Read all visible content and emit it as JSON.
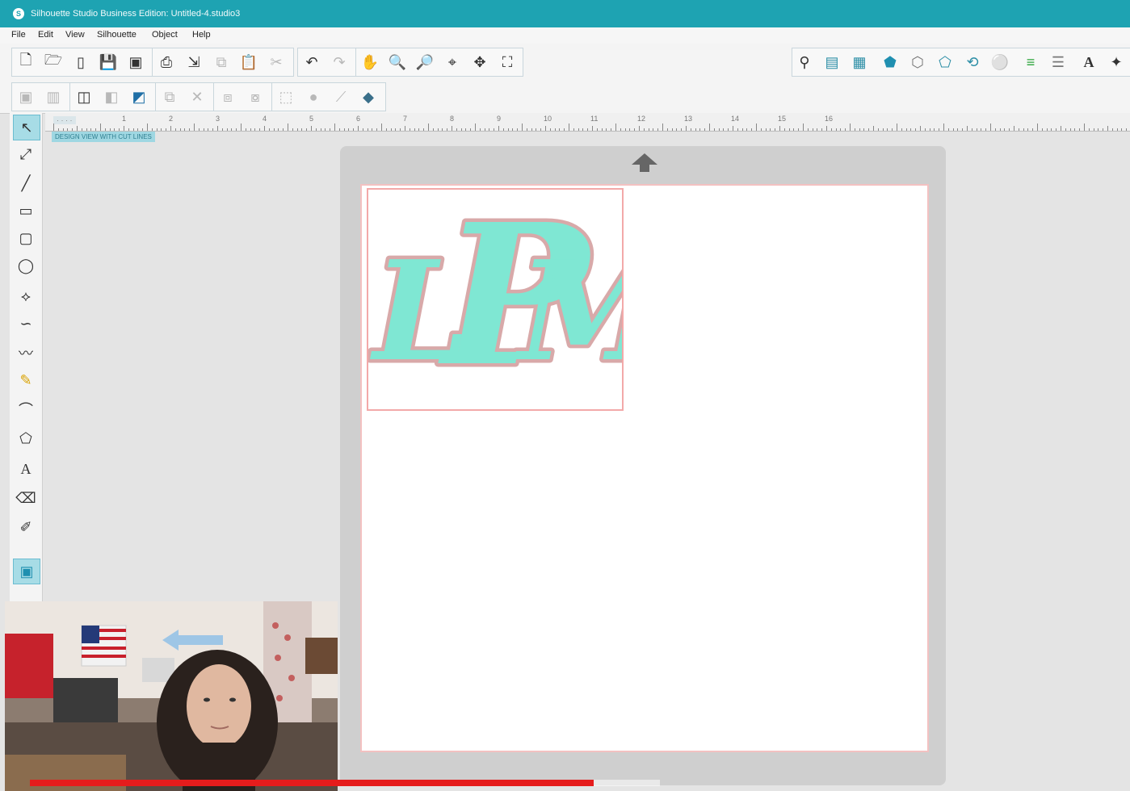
{
  "window": {
    "title": "Silhouette Studio Business Edition: Untitled-4.studio3",
    "app_icon": "S"
  },
  "menu": [
    "File",
    "Edit",
    "View",
    "Silhouette",
    "Object",
    "Help"
  ],
  "toolbar_top_left": [
    {
      "icon": "new-doc-icon",
      "glyph": "🗋"
    },
    {
      "icon": "open-folder-icon",
      "glyph": "🗁"
    },
    {
      "icon": "library-icon",
      "glyph": "▯"
    },
    {
      "icon": "save-icon",
      "glyph": "💾"
    },
    {
      "icon": "save-to-library-icon",
      "glyph": "▣"
    },
    {
      "icon": "print-icon",
      "glyph": "⎙"
    },
    {
      "icon": "send-icon",
      "glyph": "⇲"
    },
    {
      "icon": "copy-icon",
      "glyph": "⧉"
    },
    {
      "icon": "paste-icon",
      "glyph": "📋"
    },
    {
      "icon": "cut-icon",
      "glyph": "✂"
    },
    {
      "icon": "undo-icon",
      "glyph": "↶"
    },
    {
      "icon": "redo-icon",
      "glyph": "↷"
    },
    {
      "icon": "pan-hand-icon",
      "glyph": "✋"
    },
    {
      "icon": "zoom-in-icon",
      "glyph": "🔍"
    },
    {
      "icon": "zoom-out-icon",
      "glyph": "🔎"
    },
    {
      "icon": "zoom-select-icon",
      "glyph": "⌖"
    },
    {
      "icon": "drag-zoom-icon",
      "glyph": "✥"
    },
    {
      "icon": "fit-page-icon",
      "glyph": "⛶"
    }
  ],
  "toolbar_top_right": [
    {
      "icon": "fill-color-icon",
      "glyph": "⚲"
    },
    {
      "icon": "page-setup-icon",
      "glyph": "▤"
    },
    {
      "icon": "grid-icon",
      "glyph": "▦"
    },
    {
      "icon": "fill-pattern-icon",
      "glyph": "⬟"
    },
    {
      "icon": "line-style-icon",
      "glyph": "⬡"
    },
    {
      "icon": "shape-icon",
      "glyph": "⬠"
    },
    {
      "icon": "trace-icon",
      "glyph": "⟲"
    },
    {
      "icon": "replicate-icon",
      "glyph": "⚪"
    },
    {
      "icon": "line-color-icon",
      "glyph": "≡"
    },
    {
      "icon": "align-icon",
      "glyph": "☰"
    },
    {
      "icon": "text-style-icon",
      "glyph": "A"
    },
    {
      "icon": "transform-icon",
      "glyph": "✦"
    }
  ],
  "toolbar_second": [
    {
      "icon": "group-icon",
      "glyph": "▣"
    },
    {
      "icon": "ungroup-icon",
      "glyph": "▥"
    },
    {
      "icon": "compound-icon",
      "glyph": "◫"
    },
    {
      "icon": "release-compound-icon",
      "glyph": "◧"
    },
    {
      "icon": "bring-front-icon",
      "glyph": "◩"
    },
    {
      "icon": "duplicate-icon",
      "glyph": "⧉"
    },
    {
      "icon": "delete-icon",
      "glyph": "✕"
    },
    {
      "icon": "weld-icon",
      "glyph": "⧈"
    },
    {
      "icon": "subtract-icon",
      "glyph": "⧇"
    },
    {
      "icon": "offset-icon",
      "glyph": "⬚"
    },
    {
      "icon": "knife-icon",
      "glyph": "●"
    },
    {
      "icon": "eraser-icon",
      "glyph": "⟋"
    },
    {
      "icon": "stack-icon",
      "glyph": "◆"
    }
  ],
  "left_tools": [
    {
      "icon": "select-arrow-icon",
      "glyph": "↖"
    },
    {
      "icon": "edit-points-icon",
      "glyph": "⤢"
    },
    {
      "icon": "line-tool-icon",
      "glyph": "╱"
    },
    {
      "icon": "rectangle-tool-icon",
      "glyph": "▭"
    },
    {
      "icon": "rounded-rect-tool-icon",
      "glyph": "▢"
    },
    {
      "icon": "ellipse-tool-icon",
      "glyph": "◯"
    },
    {
      "icon": "polygon-tool-icon",
      "glyph": "⟡"
    },
    {
      "icon": "curve-tool-icon",
      "glyph": "∽"
    },
    {
      "icon": "freehand-tool-icon",
      "glyph": "〰"
    },
    {
      "icon": "smooth-freehand-icon",
      "glyph": "✎"
    },
    {
      "icon": "arc-tool-icon",
      "glyph": "⌒"
    },
    {
      "icon": "regular-polygon-icon",
      "glyph": "⬠"
    },
    {
      "icon": "text-tool-icon",
      "glyph": "A"
    },
    {
      "icon": "eraser-tool-icon",
      "glyph": "⌫"
    },
    {
      "icon": "knife-tool-icon",
      "glyph": "✐"
    },
    {
      "icon": "design-view-icon",
      "glyph": "▣"
    }
  ],
  "ruler_numbers": [
    "1",
    "2",
    "3",
    "4",
    "5",
    "6",
    "7",
    "8",
    "9",
    "10",
    "11",
    "12",
    "13",
    "14",
    "15",
    "16"
  ],
  "view_tag": "DESIGN VIEW WITH CUT LINES",
  "monogram": {
    "left": "L",
    "center": "P",
    "right": "M",
    "fill": "#7fe7d3",
    "outline": "#d8a9a9"
  },
  "video": {
    "progress": 0.895
  }
}
